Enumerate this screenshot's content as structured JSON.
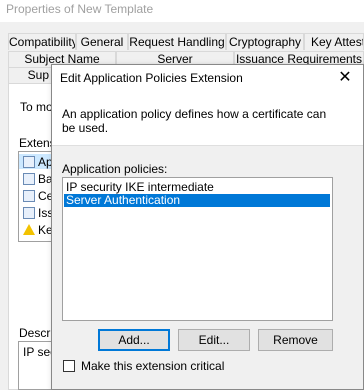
{
  "parent": {
    "title": "Properties of New Template",
    "tabs_row1": [
      "Compatibility",
      "General",
      "Request Handling",
      "Cryptography",
      "Key Attesta"
    ],
    "tabs_row2": [
      "Subject Name",
      "Server",
      "Issuance Requirements"
    ],
    "tabs_row3_partial": [
      "Sup",
      "rity"
    ],
    "instruction_partial": "To mod",
    "extensions_label_partial": "Extens",
    "extension_items_partial": [
      "Ap",
      "Ba",
      "Ce",
      "Iss",
      "Ke"
    ],
    "description_label_partial": "Descrip",
    "description_text_partial": "IP sec",
    "edit_button_partial": "..."
  },
  "dialog": {
    "title": "Edit Application Policies Extension",
    "description": "An application policy defines how a certificate can be used.",
    "policies_label": "Application policies:",
    "policies": [
      {
        "label": "IP security IKE intermediate",
        "selected": false
      },
      {
        "label": "Server Authentication",
        "selected": true
      }
    ],
    "buttons": {
      "add": "Add...",
      "edit": "Edit...",
      "remove": "Remove"
    },
    "critical_label": "Make this extension critical",
    "critical_checked": false,
    "colors": {
      "selection": "#0078d7",
      "default_button_border": "#0078d7"
    }
  }
}
